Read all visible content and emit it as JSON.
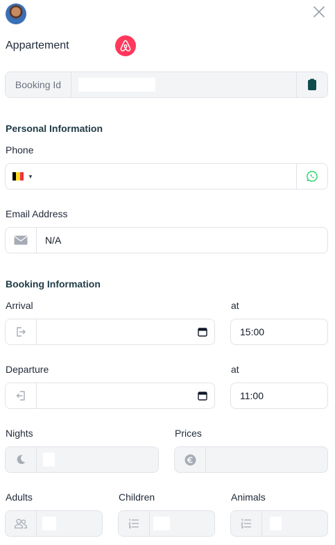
{
  "header": {
    "title": "Appartement",
    "source_icon": "airbnb-icon",
    "close_icon": "close-icon"
  },
  "booking_id": {
    "label": "Booking Id",
    "value": "",
    "copy_icon": "clipboard-icon"
  },
  "personal": {
    "heading": "Personal Information",
    "phone_label": "Phone",
    "phone_country": "BE",
    "phone_value": "",
    "whatsapp_icon": "whatsapp-icon",
    "email_label": "Email Address",
    "email_value": "N/A"
  },
  "booking": {
    "heading": "Booking Information",
    "arrival_label": "Arrival",
    "arrival_date": "",
    "at_label": "at",
    "arrival_time": "15:00",
    "departure_label": "Departure",
    "departure_date": "",
    "departure_time": "11:00",
    "nights_label": "Nights",
    "nights_value": "",
    "prices_label": "Prices",
    "prices_value": "",
    "adults_label": "Adults",
    "adults_value": "",
    "children_label": "Children",
    "children_value": "",
    "animals_label": "Animals",
    "animals_value": ""
  },
  "colors": {
    "accent": "#ff385c",
    "heading": "#1e3a45",
    "whatsapp": "#25d366",
    "clipboard": "#0f4c4c"
  }
}
